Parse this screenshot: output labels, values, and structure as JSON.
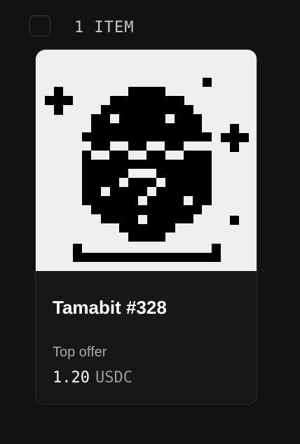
{
  "header": {
    "item_count_label": "1 ITEM",
    "select_all_checked": false
  },
  "card": {
    "title": "Tamabit #328",
    "offer_label": "Top offer",
    "price_value": "1.20",
    "price_currency": "USDC",
    "artwork_icon": "pixel-egg-question-icon"
  },
  "colors": {
    "background": "#121212",
    "card_background": "#171717",
    "artwork_background": "#efefef",
    "pixel_ink": "#000000",
    "muted_text": "#a8a8a8"
  }
}
